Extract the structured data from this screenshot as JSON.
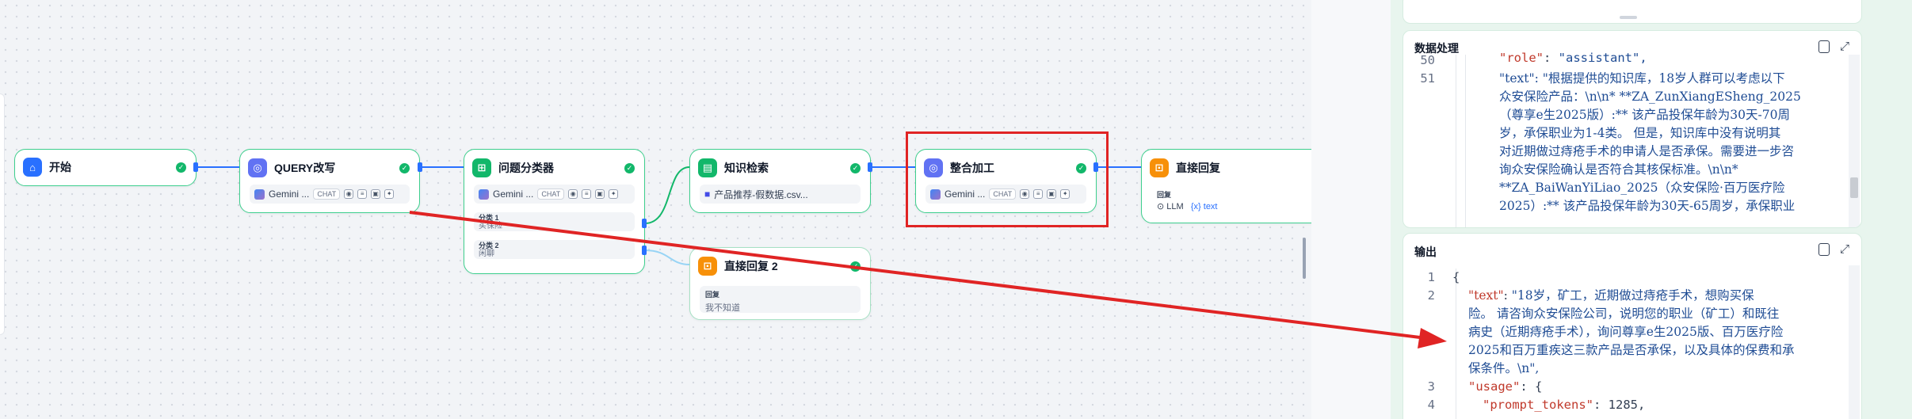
{
  "workflow": {
    "nodes": {
      "start": {
        "title": "开始"
      },
      "query_rewrite": {
        "title": "QUERY改写",
        "model": "Gemini ...",
        "tag": "CHAT"
      },
      "classifier": {
        "title": "问题分类器",
        "model": "Gemini ...",
        "tag": "CHAT",
        "classes": [
          {
            "label": "分类 1",
            "value": "买保险"
          },
          {
            "label": "分类 2",
            "value": "闲聊"
          }
        ]
      },
      "knowledge": {
        "title": "知识检索",
        "dataset": "产品推荐-假数据.csv..."
      },
      "integrate": {
        "title": "整合加工",
        "model": "Gemini ...",
        "tag": "CHAT"
      },
      "reply": {
        "title": "直接回复",
        "section": "回复",
        "llm_label": "LLM",
        "var_label": "{x} text"
      },
      "reply2": {
        "title": "直接回复 2",
        "section": "回复",
        "value": "我不知道"
      }
    }
  },
  "panel": {
    "data_processing": {
      "title": "数据处理",
      "line_numbers": [
        "50",
        "51"
      ],
      "line50": {
        "key": "\"role\"",
        "sep": ": ",
        "value": "\"assistant\","
      },
      "line51": [
        "\"text\": \"根据提供的知识库，18岁人群可以考虑以下",
        "众安保险产品：\\n\\n* **ZA_ZunXiangESheng_2025",
        "（尊享e生2025版）:**  该产品投保年龄为30天-70周",
        "岁，承保职业为1-4类。   但是，知识库中没有说明其",
        "对近期做过痔疮手术的申请人是否承保。需要进一步咨",
        "询众安保险确认是否符合其核保标准。\\n\\n*",
        "**ZA_BaiWanYiLiao_2025（众安保险·百万医疗险",
        "2025）:** 该产品投保年龄为30天-65周岁，承保职业"
      ]
    },
    "output": {
      "title": "输出",
      "line_numbers": [
        "1",
        "2",
        "3",
        "4"
      ],
      "open_brace": "{",
      "text_key": "\"text\"",
      "text_lines": [
        "\"18岁，矿工，近期做过痔疮手术，想购买保",
        "险。  请咨询众安保险公司，说明您的职业（矿工）和既往",
        "病史（近期痔疮手术），询问尊享e生2025版、百万医疗险",
        "2025和百万重疾这三款产品是否承保，以及具体的保费和承",
        "保条件。\\n\","
      ],
      "usage_key": "\"usage\"",
      "usage_open": ": {",
      "prompt_tokens_key": "\"prompt_tokens\"",
      "prompt_tokens_value": "1285,"
    }
  },
  "colors": {
    "accent": "#2970ff",
    "node_border": "#3ecf8e",
    "annotation": "#e02424",
    "panel_bg": "#e8f5ee"
  }
}
